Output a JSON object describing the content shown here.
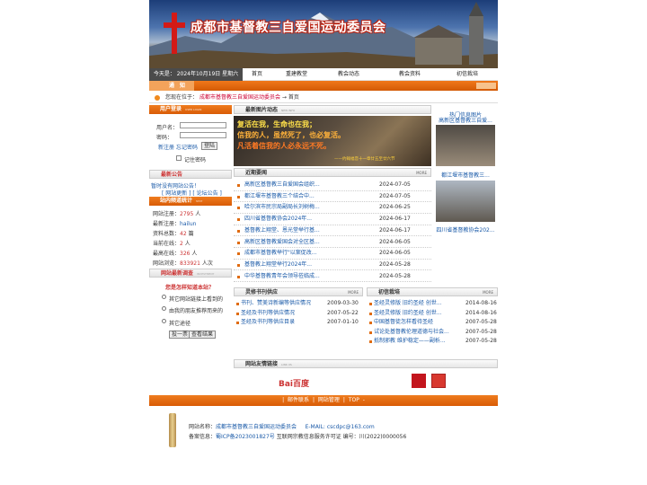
{
  "header": {
    "title": "成都市基督教三自爱国运动委员会"
  },
  "nav": {
    "date": "今天是： 2024年10月19日 星期六",
    "items": [
      "首页",
      "重建教堂",
      "教会动态",
      "教会资料",
      "初信栽培"
    ]
  },
  "notice": {
    "label": "通　知"
  },
  "breadcrumb": {
    "prefix": "您现在位于：",
    "home": "成都市基督教三自爱国运动委员会",
    "sep": "→",
    "current": "首页"
  },
  "login": {
    "title": "用户登录",
    "title_en": "USER LOGIN",
    "user_label": "用户名：",
    "pass_label": "密码：",
    "register": "新注册",
    "forgot": "忘记密码",
    "login_btn": "登陆",
    "remember": "记住密码"
  },
  "latest_notice": {
    "title": "最新公告",
    "text": "暂时没有网站公告！",
    "more": "[ 网站更新 ] [ 论坛公告 ]"
  },
  "site_stats": {
    "title": "站内频道统计",
    "title_en": "STAT",
    "rows": [
      {
        "label": "网站注册：",
        "value": "2795",
        "unit": " 人"
      },
      {
        "label": "最新注册：",
        "value": "hailun",
        "unit": ""
      },
      {
        "label": "资料总数：",
        "value": "42",
        "unit": " 篇"
      },
      {
        "label": "当前在线：",
        "value": "2",
        "unit": " 人"
      },
      {
        "label": "最高在线：",
        "value": "326",
        "unit": " 人"
      },
      {
        "label": "网站浏览：",
        "value": "833921",
        "unit": " 人次"
      }
    ]
  },
  "survey": {
    "title": "网站最新调查",
    "title_en": "INVESTMENT",
    "question": "您是怎样知道本站？",
    "options": [
      "其它网站链接上看到的",
      "由我的朋友推荐而来的",
      "其它途径"
    ],
    "vote_btn": "投一票",
    "result_btn": "查看结果"
  },
  "latest_news": {
    "title": "最新图片动态",
    "title_en": "NEW INFO"
  },
  "hero": {
    "line1": "复活在我，生命也在我；",
    "line2": "信我的人，虽然死了，也必复活。",
    "line3": "凡活着信我的人必永远不死。",
    "source": "——约翰福音十一章廿五至廿六节"
  },
  "recent_news": {
    "title": "近期要闻",
    "more": "MORE",
    "items": [
      {
        "title": "高新区基督教三自爱国会组织...",
        "date": "2024-07-05"
      },
      {
        "title": "都江堰市基督教三个结合中...",
        "date": "2024-07-05"
      },
      {
        "title": "哈尔滨市民宗局副局长刘树梅...",
        "date": "2024-06-25"
      },
      {
        "title": "四川省基督教协会2024年...",
        "date": "2024-06-17"
      },
      {
        "title": "基督教上翔堂、恩光堂举行基...",
        "date": "2024-06-17"
      },
      {
        "title": "高新区基督教爱国会对全区基...",
        "date": "2024-06-05"
      },
      {
        "title": "成都市基督教举行\"以案促改...",
        "date": "2024-06-05"
      },
      {
        "title": "基督教上翔堂举行2024年...",
        "date": "2024-05-28"
      },
      {
        "title": "中华基督教青年会领导莅临成...",
        "date": "2024-05-28"
      }
    ]
  },
  "hot_photos": {
    "title": "热门信息图片",
    "items": [
      "高新区基督教三自爱...",
      "都江堰市基督教三...",
      "四川省基督教协会202..."
    ]
  },
  "books": {
    "title": "灵修书刊供应",
    "more": "MORE",
    "items": [
      {
        "title": "书刊、赞美诗新编等供应情况",
        "date": "2009-03-30"
      },
      {
        "title": "圣经及书刊等供应情况",
        "date": "2007-05-22"
      },
      {
        "title": "圣经及书刊等供应目录",
        "date": "2007-01-10"
      }
    ]
  },
  "growth": {
    "title": "初信栽培",
    "more": "MORE",
    "items": [
      {
        "title": "圣经灵修版 旧约圣经 创世...",
        "date": "2014-08-16"
      },
      {
        "title": "圣经灵修版 旧约圣经 创世...",
        "date": "2014-08-16"
      },
      {
        "title": "中国基督徒怎样看待圣经",
        "date": "2007-05-28"
      },
      {
        "title": "试论处基督教伦理道德与社会...",
        "date": "2007-05-28"
      },
      {
        "title": "抵制邪教 维护稳定——副析...",
        "date": "2007-05-28"
      }
    ]
  },
  "friend_links": {
    "title": "网站友情链接",
    "title_en": "LINK US",
    "baidu": "Bai百度"
  },
  "footer_nav": {
    "items": [
      "|",
      "邮件联系",
      "|",
      "网站管理",
      "|",
      "TOP",
      "-"
    ]
  },
  "footer": {
    "name_label": "网站名称：",
    "name": "成都市基督教三自爱国运动委员会",
    "email_label": "E-MAIL:",
    "email": "cscdpc@163.com",
    "icp_label": "备案信息：",
    "icp": "蜀ICP备2023001827号",
    "icp_extra": "互联网宗教信息服务许可证 编号：川(2022)0000056"
  },
  "colors": {
    "orange": "#e0640c",
    "link": "#1a5aa8",
    "red": "#c33"
  }
}
